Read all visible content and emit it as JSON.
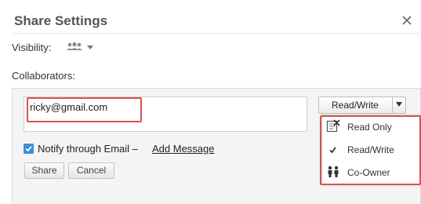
{
  "dialog": {
    "title": "Share Settings"
  },
  "visibility": {
    "label": "Visibility:",
    "icon": "people-icon"
  },
  "collaborators": {
    "label": "Collaborators:",
    "email_value": "ricky@gmail.com",
    "permission_selected": "Read/Write",
    "notify_checked": true,
    "notify_label": "Notify through Email –",
    "add_message_label": "Add Message"
  },
  "buttons": {
    "share_label": "Share",
    "cancel_label": "Cancel"
  },
  "permission_menu": {
    "items": [
      {
        "label": "Read Only",
        "icon": "read-only-icon",
        "selected": false
      },
      {
        "label": "Read/Write",
        "icon": "check-icon",
        "selected": true
      },
      {
        "label": "Co-Owner",
        "icon": "co-owner-icon",
        "selected": false
      }
    ]
  },
  "colors": {
    "highlight_red": "#d9534f",
    "checkbox_blue": "#3b8fd6"
  }
}
